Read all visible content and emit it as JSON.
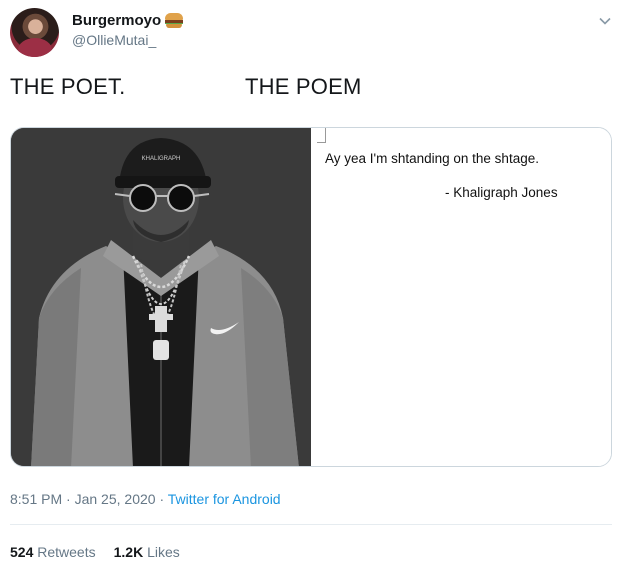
{
  "author": {
    "display_name": "Burgermoyo",
    "emoji_icon": "burger-icon",
    "handle": "@OllieMutai_"
  },
  "tweet": {
    "text": "THE POET.                   THE POEM"
  },
  "media": {
    "quote_line": "Ay yea I'm shtanding on the shtage.",
    "quote_author": "- Khaligraph Jones",
    "photo_cap_text": "KHALIGRAPH"
  },
  "meta": {
    "time": "8:51 PM",
    "date": "Jan 25, 2020",
    "separator": "·",
    "source": "Twitter for Android"
  },
  "stats": {
    "retweets_count": "524",
    "retweets_label": "Retweets",
    "likes_count": "1.2K",
    "likes_label": "Likes"
  },
  "colors": {
    "link": "#1b95e0",
    "muted": "#657786",
    "text": "#14171a",
    "border": "#ccd6dd"
  }
}
